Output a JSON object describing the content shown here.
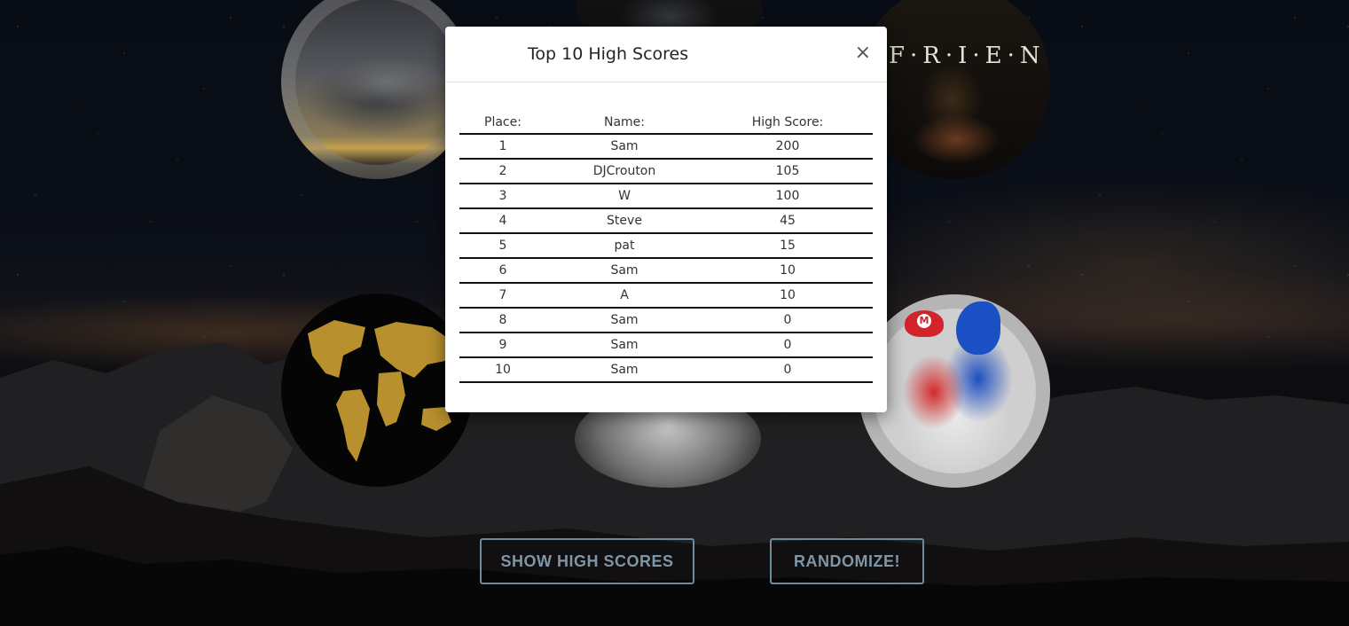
{
  "modal": {
    "title": "Top 10 High Scores",
    "close_label": "×",
    "columns": [
      "Place:",
      "Name:",
      "High Score:"
    ],
    "rows": [
      {
        "place": "1",
        "name": "Sam",
        "score": "200"
      },
      {
        "place": "2",
        "name": "DJCrouton",
        "score": "105"
      },
      {
        "place": "3",
        "name": "W",
        "score": "100"
      },
      {
        "place": "4",
        "name": "Steve",
        "score": "45"
      },
      {
        "place": "5",
        "name": "pat",
        "score": "15"
      },
      {
        "place": "6",
        "name": "Sam",
        "score": "10"
      },
      {
        "place": "7",
        "name": "A",
        "score": "10"
      },
      {
        "place": "8",
        "name": "Sam",
        "score": "0"
      },
      {
        "place": "9",
        "name": "Sam",
        "score": "0"
      },
      {
        "place": "10",
        "name": "Sam",
        "score": "0"
      }
    ]
  },
  "tiles": {
    "friends_logo_text": "F·R·I·E·N·D·S"
  },
  "buttons": {
    "show_high_scores": "SHOW HIGH SCORES",
    "randomize": "RANDOMIZE!"
  },
  "colors": {
    "button_border": "#6e8a9d",
    "button_text": "#7f96a6",
    "modal_bg": "#ffffff"
  }
}
